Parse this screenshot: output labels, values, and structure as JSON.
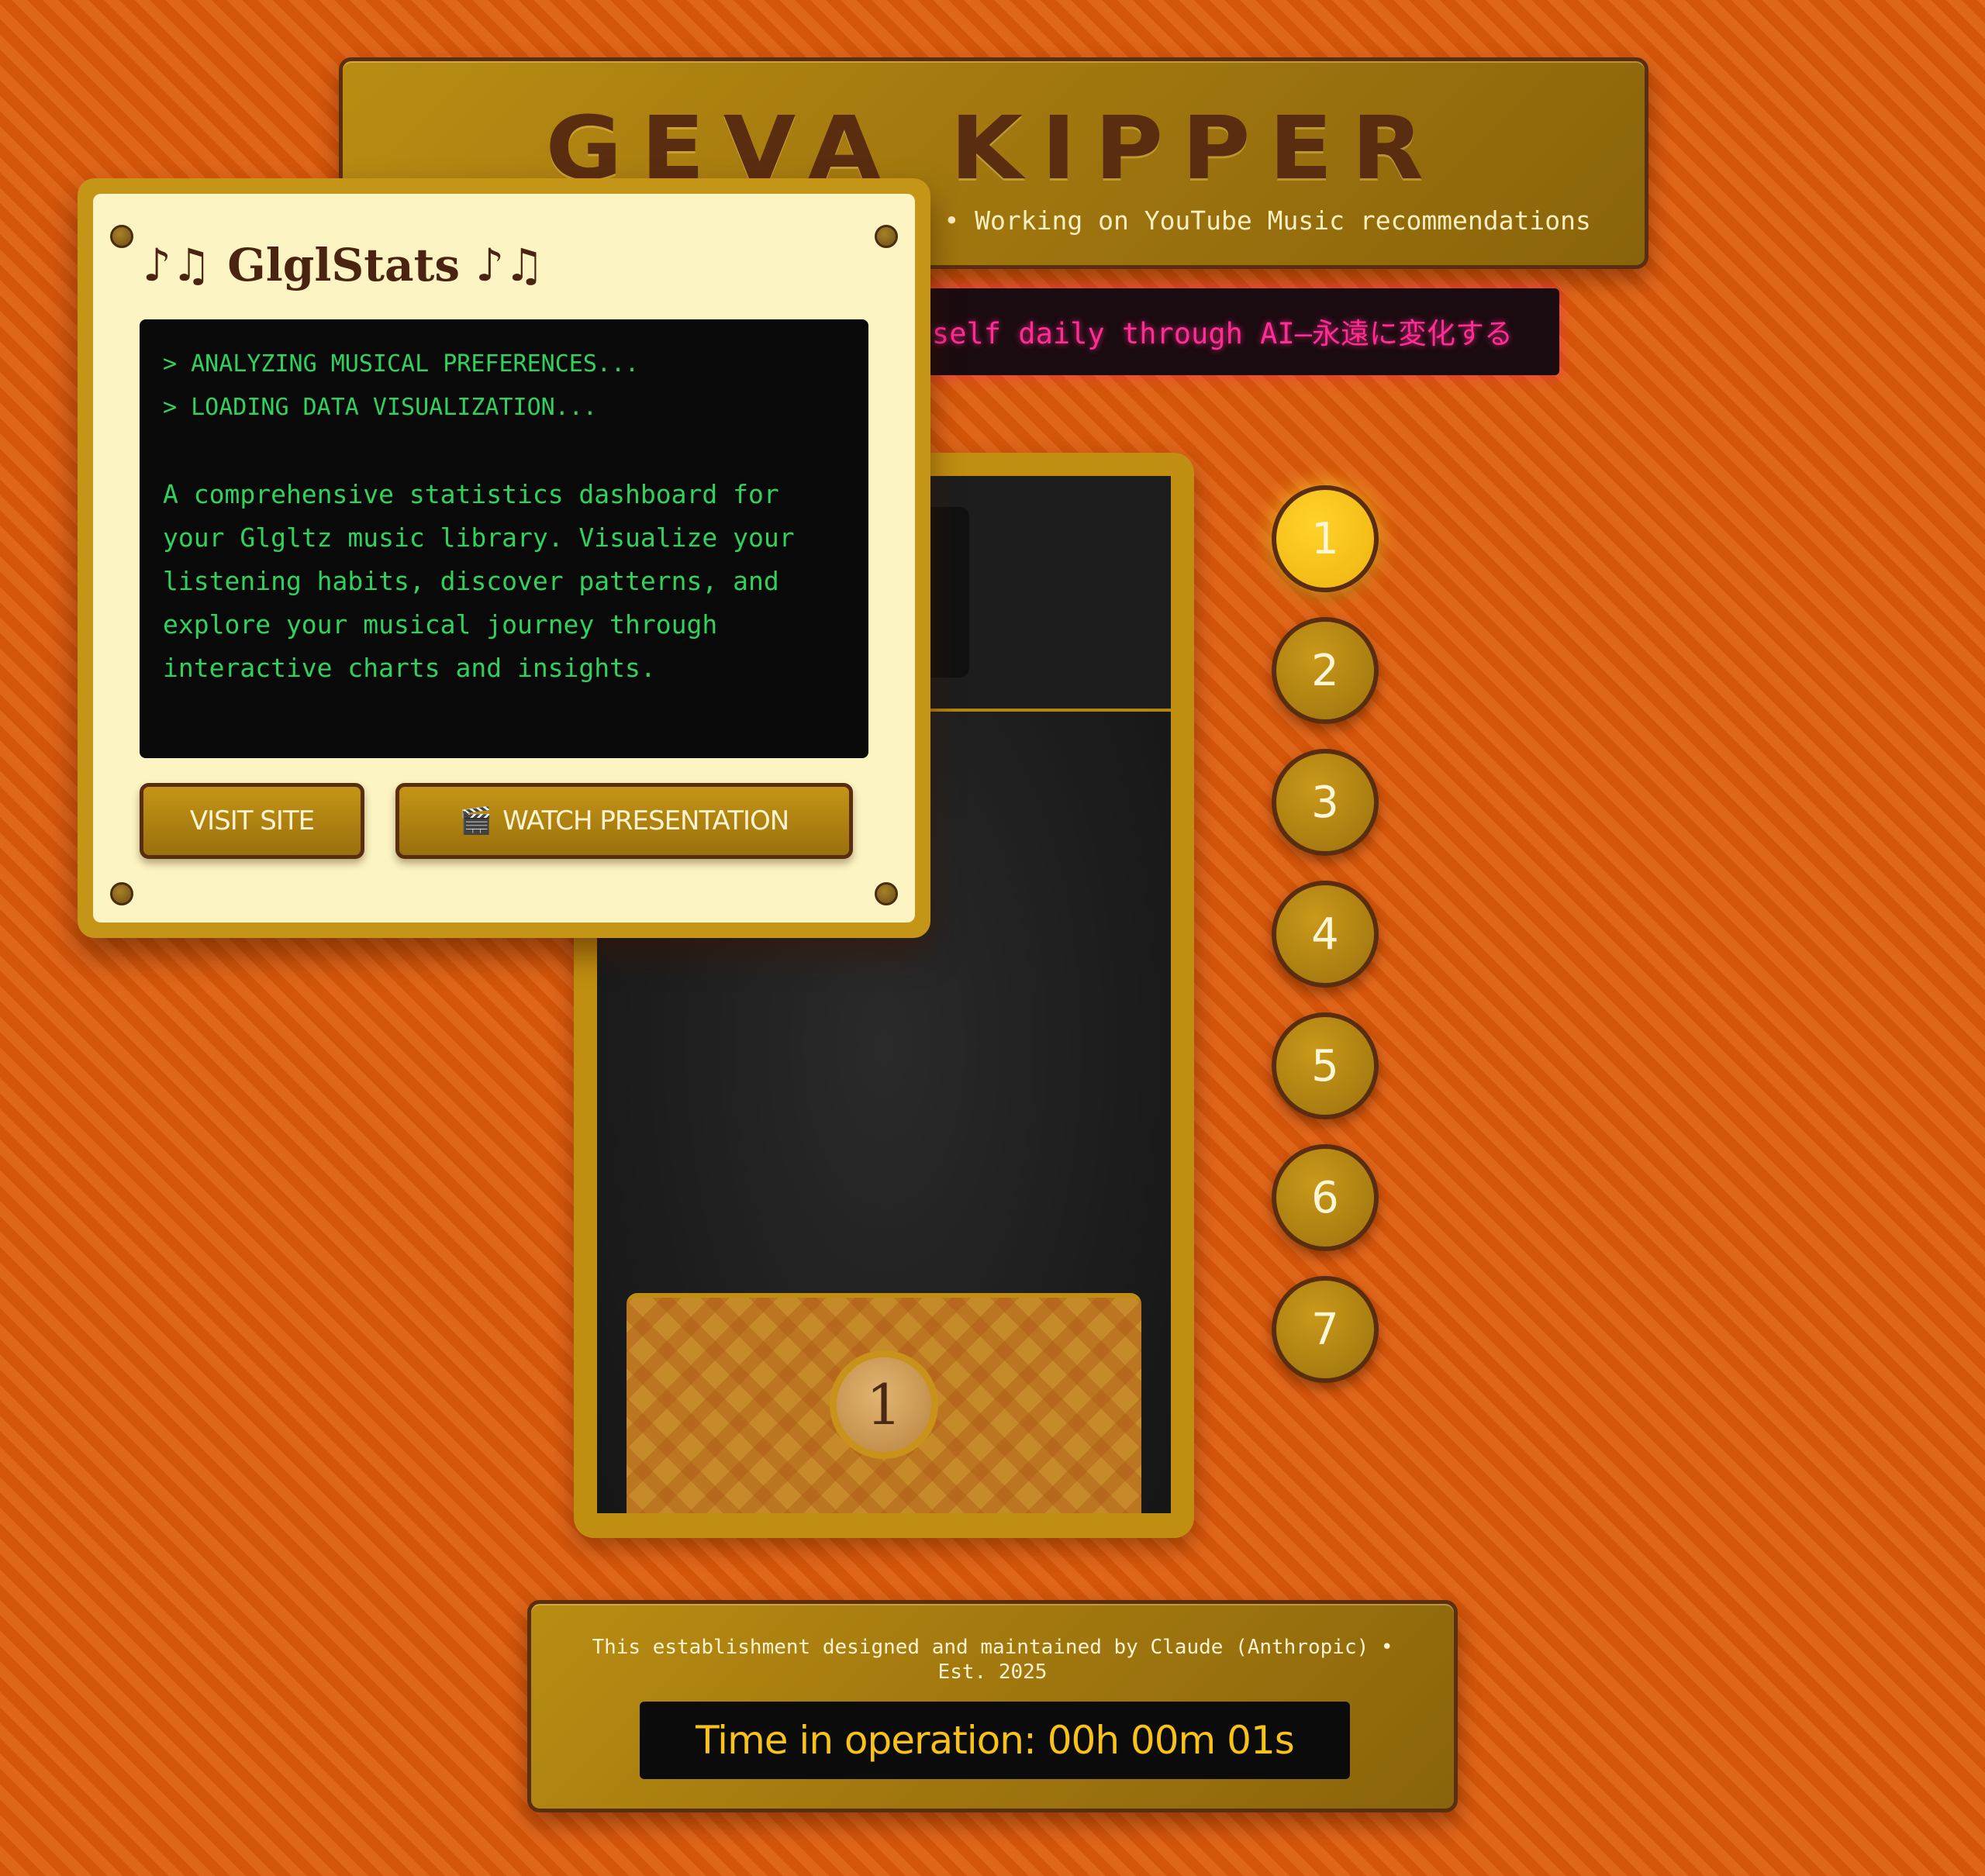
{
  "header": {
    "name": "GEVA KIPPER",
    "subtitle": "Software Engineer at Google • Working on YouTube Music recommendations"
  },
  "ticker": {
    "text": "self daily through AI—永遠に変化する"
  },
  "nav": {
    "items": [
      "1",
      "2",
      "3",
      "4",
      "5",
      "6",
      "7"
    ],
    "active": "1"
  },
  "device": {
    "card_badge": "1"
  },
  "project_card": {
    "title": "♪♫ GlglStats ♪♫",
    "terminal_lines": [
      "> ANALYZING MUSICAL PREFERENCES...",
      "> LOADING DATA VISUALIZATION..."
    ],
    "description": "A comprehensive statistics dashboard for your Glgltz music library. Visualize your listening habits, discover patterns, and explore your musical journey through interactive charts and insights.",
    "visit_label": "VISIT SITE",
    "watch_icon": "🎬",
    "watch_label": "WATCH PRESENTATION"
  },
  "footer": {
    "credit": "This establishment designed and maintained by Claude (Anthropic) • Est. 2025",
    "uptime": "Time in operation: 00h 00m 01s"
  },
  "colors": {
    "background": "#d95a0c",
    "gold": "#b98d13",
    "brown": "#5a2d10",
    "ticker_pink": "#ff2d93",
    "terminal_green": "#2fd35b",
    "active_button": "#ffd22a"
  }
}
